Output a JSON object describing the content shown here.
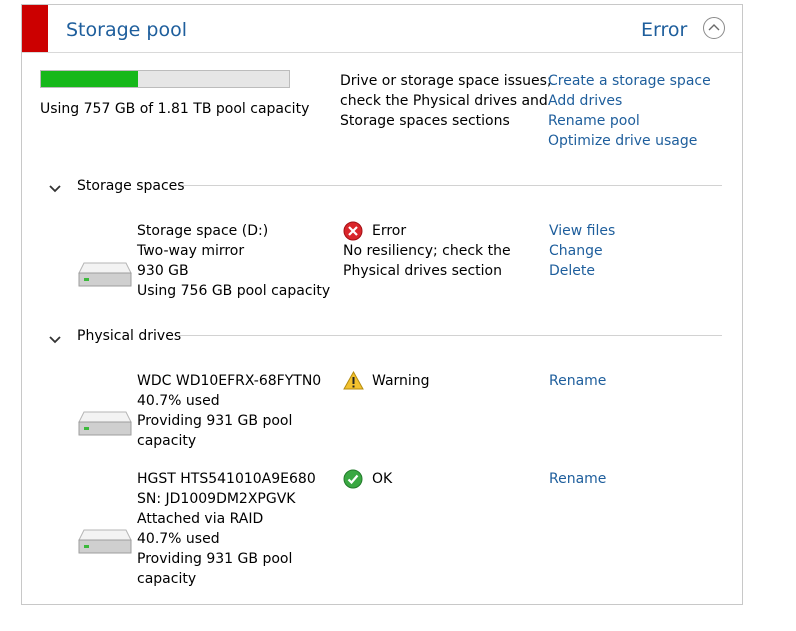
{
  "header": {
    "title": "Storage pool",
    "status": "Error",
    "accent_color": "#cc0000",
    "collapse_icon": "chevron-up-circle"
  },
  "pool": {
    "usage_fraction": 0.3915,
    "usage_text": "Using 757 GB of 1.81 TB pool capacity",
    "message_line1": "Drive or storage space issues;",
    "message_line2": "check the Physical drives and",
    "message_line3": "Storage spaces sections",
    "actions": [
      "Create a storage space",
      "Add drives",
      "Rename pool",
      "Optimize drive usage"
    ]
  },
  "storage_spaces": {
    "heading": "Storage spaces",
    "items": [
      {
        "lines": [
          "Storage space (D:)",
          "Two-way mirror",
          "930 GB",
          "Using 756 GB pool capacity"
        ],
        "status": "Error",
        "status_icon": "error-icon",
        "status_detail": [
          "No resiliency; check the",
          "Physical drives section"
        ],
        "actions": [
          "View files",
          "Change",
          "Delete"
        ]
      }
    ]
  },
  "physical_drives": {
    "heading": "Physical drives",
    "items": [
      {
        "lines": [
          "WDC WD10EFRX-68FYTN0",
          "40.7% used",
          "Providing 931 GB pool",
          "capacity"
        ],
        "status": "Warning",
        "status_icon": "warning-icon",
        "actions": [
          "Rename"
        ]
      },
      {
        "lines": [
          "HGST HTS541010A9E680",
          "SN: JD1009DM2XPGVK",
          "Attached via RAID",
          "40.7% used",
          "Providing 931 GB pool",
          "capacity"
        ],
        "status": "OK",
        "status_icon": "ok-icon",
        "actions": [
          "Rename"
        ]
      }
    ]
  },
  "colors": {
    "link": "#1e5e9c",
    "usage_bar": "#16b81a",
    "error": "#d9262b",
    "warning": "#f2c12e",
    "ok": "#3aa842"
  }
}
